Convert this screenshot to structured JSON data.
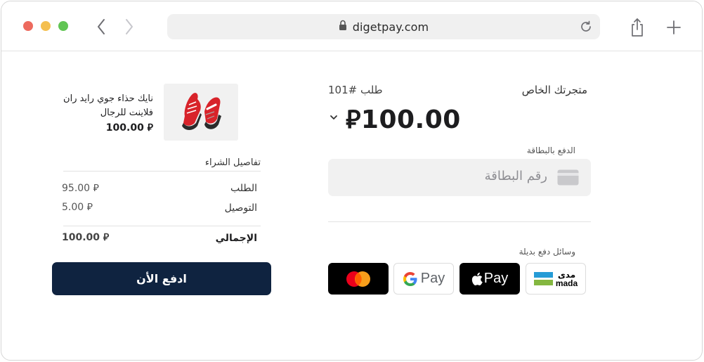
{
  "browser": {
    "url": "digetpay.com",
    "icons": [
      "back-chevron-icon",
      "forward-chevron-icon",
      "lock-icon",
      "reload-icon",
      "share-icon",
      "plus-icon"
    ]
  },
  "order_summary": {
    "product": {
      "name_line1": "نايك حذاء جوي رايد ران",
      "name_line2": "فلاينت للرجال",
      "price": "100.00 ⃁"
    },
    "details_title": "تفاصيل الشراء",
    "rows": [
      {
        "label": "الطلب",
        "value": "95.00 ⃁"
      },
      {
        "label": "التوصيل",
        "value": "5.00 ⃁"
      },
      {
        "label": "الإجمالي",
        "value": "100.00 ⃁"
      }
    ],
    "pay_button": "ادفع الأن"
  },
  "payment": {
    "store_name": "متجرتك الخاص",
    "order_number": "طلب #101",
    "amount": "100.00",
    "currency_symbol": "⃁",
    "card_label": "الدفع بالبطاقة",
    "card_placeholder": "رقم البطاقة",
    "alt_methods_label": "وسائل دفع بديلة",
    "methods": [
      {
        "name": "Mastercard"
      },
      {
        "name": "Google Pay",
        "text": "Pay"
      },
      {
        "name": "Apple Pay",
        "text": "Pay"
      },
      {
        "name": "mada",
        "text_ar": "مدى",
        "text_en": "mada"
      }
    ]
  },
  "colors": {
    "pay_button": "#0f2340",
    "input_bg": "#f1f1f1",
    "mastercard_red": "#eb001b",
    "mastercard_orange": "#f79e1b",
    "mada_blue": "#259bd6",
    "mada_green": "#84b740"
  }
}
